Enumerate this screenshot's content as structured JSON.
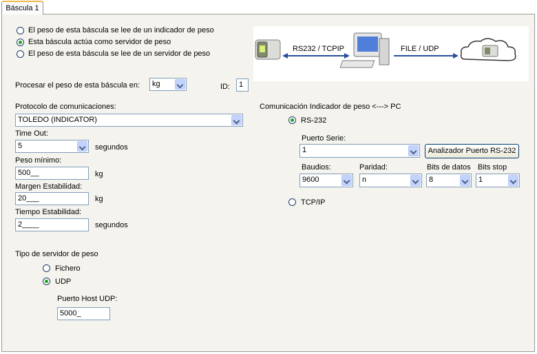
{
  "tab": {
    "label": "Báscula 1"
  },
  "source": {
    "options": [
      {
        "label": "El peso de esta báscula se lee de un indicador de peso",
        "checked": false
      },
      {
        "label": "Esta báscula actúa como servidor de peso",
        "checked": true
      },
      {
        "label": "El peso de esta báscula se lee de un servidor de peso",
        "checked": false
      }
    ]
  },
  "diagram": {
    "left_label": "RS232 / TCPIP",
    "right_label": "FILE / UDP"
  },
  "process": {
    "label": "Procesar el peso de esta báscula en:",
    "unit": "kg",
    "id_label": "ID:",
    "id_value": "1"
  },
  "protocol": {
    "label": "Protocolo de comunicaciones:",
    "value": "TOLEDO (INDICATOR)"
  },
  "timeout": {
    "label": "Time Out:",
    "value": "5",
    "unit": "segundos"
  },
  "min_weight": {
    "label": "Peso mínimo:",
    "value": "500__",
    "unit": "kg"
  },
  "stability_margin": {
    "label": "Margen Estabilidad:",
    "value": "20___",
    "unit": "kg"
  },
  "stability_time": {
    "label": "Tiempo Estabilidad:",
    "value": "2____",
    "unit": "segundos"
  },
  "server_type": {
    "label": "Tipo de servidor de peso",
    "options": [
      {
        "label": "Fichero",
        "checked": false
      },
      {
        "label": "UDP",
        "checked": true
      }
    ],
    "port_label": "Puerto Host UDP:",
    "port_value": "5000_"
  },
  "comm": {
    "label": "Comunicación Indicador de peso <---> PC",
    "rs232_label": "RS-232",
    "rs232_checked": true,
    "serial_port_label": "Puerto Serie:",
    "serial_port_value": "1",
    "analyzer_button": "Analizador Puerto RS-232",
    "baud_label": "Baudios:",
    "baud_value": "9600",
    "parity_label": "Paridad:",
    "parity_value": "n",
    "databits_label": "Bits de datos",
    "databits_value": "8",
    "stopbits_label": "Bits stop",
    "stopbits_value": "1",
    "tcpip_label": "TCP/IP",
    "tcpip_checked": false
  },
  "colors": {
    "panel": "#f4f3ee",
    "radio_dot": "#21a121",
    "arrow": "#2a4fa0",
    "tab_accent": "#f0b84a"
  }
}
